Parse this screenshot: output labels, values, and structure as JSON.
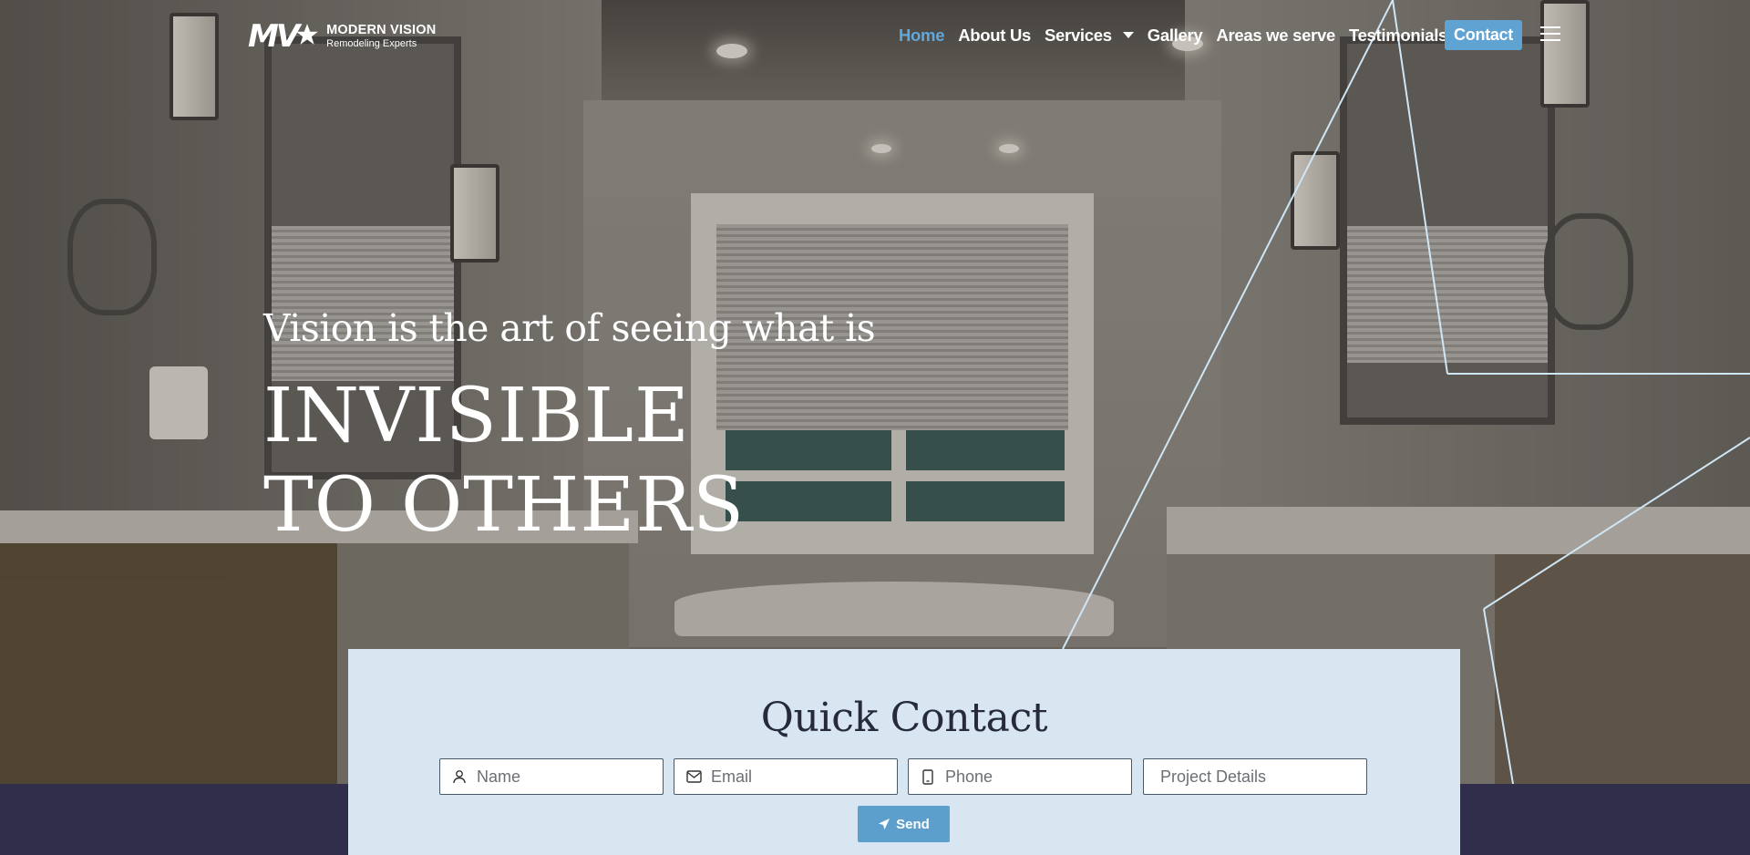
{
  "brand": {
    "logo_mark": "MV",
    "name": "MODERN VISION",
    "tagline": "Remodeling Experts"
  },
  "nav": {
    "items": [
      {
        "label": "Home",
        "active": true
      },
      {
        "label": "About Us"
      },
      {
        "label": "Services",
        "has_dropdown": true
      },
      {
        "label": "Gallery"
      },
      {
        "label": "Areas we serve"
      },
      {
        "label": "Testimonials"
      }
    ],
    "contact_label": "Contact",
    "menu_icon": "hamburger-menu-icon"
  },
  "hero": {
    "subtitle": "Vision is the art of seeing what is",
    "title": "INVISIBLE TO OTHERS"
  },
  "quick_contact": {
    "title": "Quick Contact",
    "fields": [
      {
        "placeholder": "Name",
        "icon": "user-icon"
      },
      {
        "placeholder": "Email",
        "icon": "envelope-icon"
      },
      {
        "placeholder": "Phone",
        "icon": "phone-icon"
      },
      {
        "placeholder": "Project Details",
        "icon": ""
      }
    ],
    "send_label": "Send",
    "send_icon": "paper-plane-icon"
  },
  "colors": {
    "accent": "#5fa3d3",
    "active_nav": "#5fa8dc",
    "card_bg": "#d7e6f1",
    "band_bg": "#302e4b",
    "title_text": "#262a3a"
  }
}
